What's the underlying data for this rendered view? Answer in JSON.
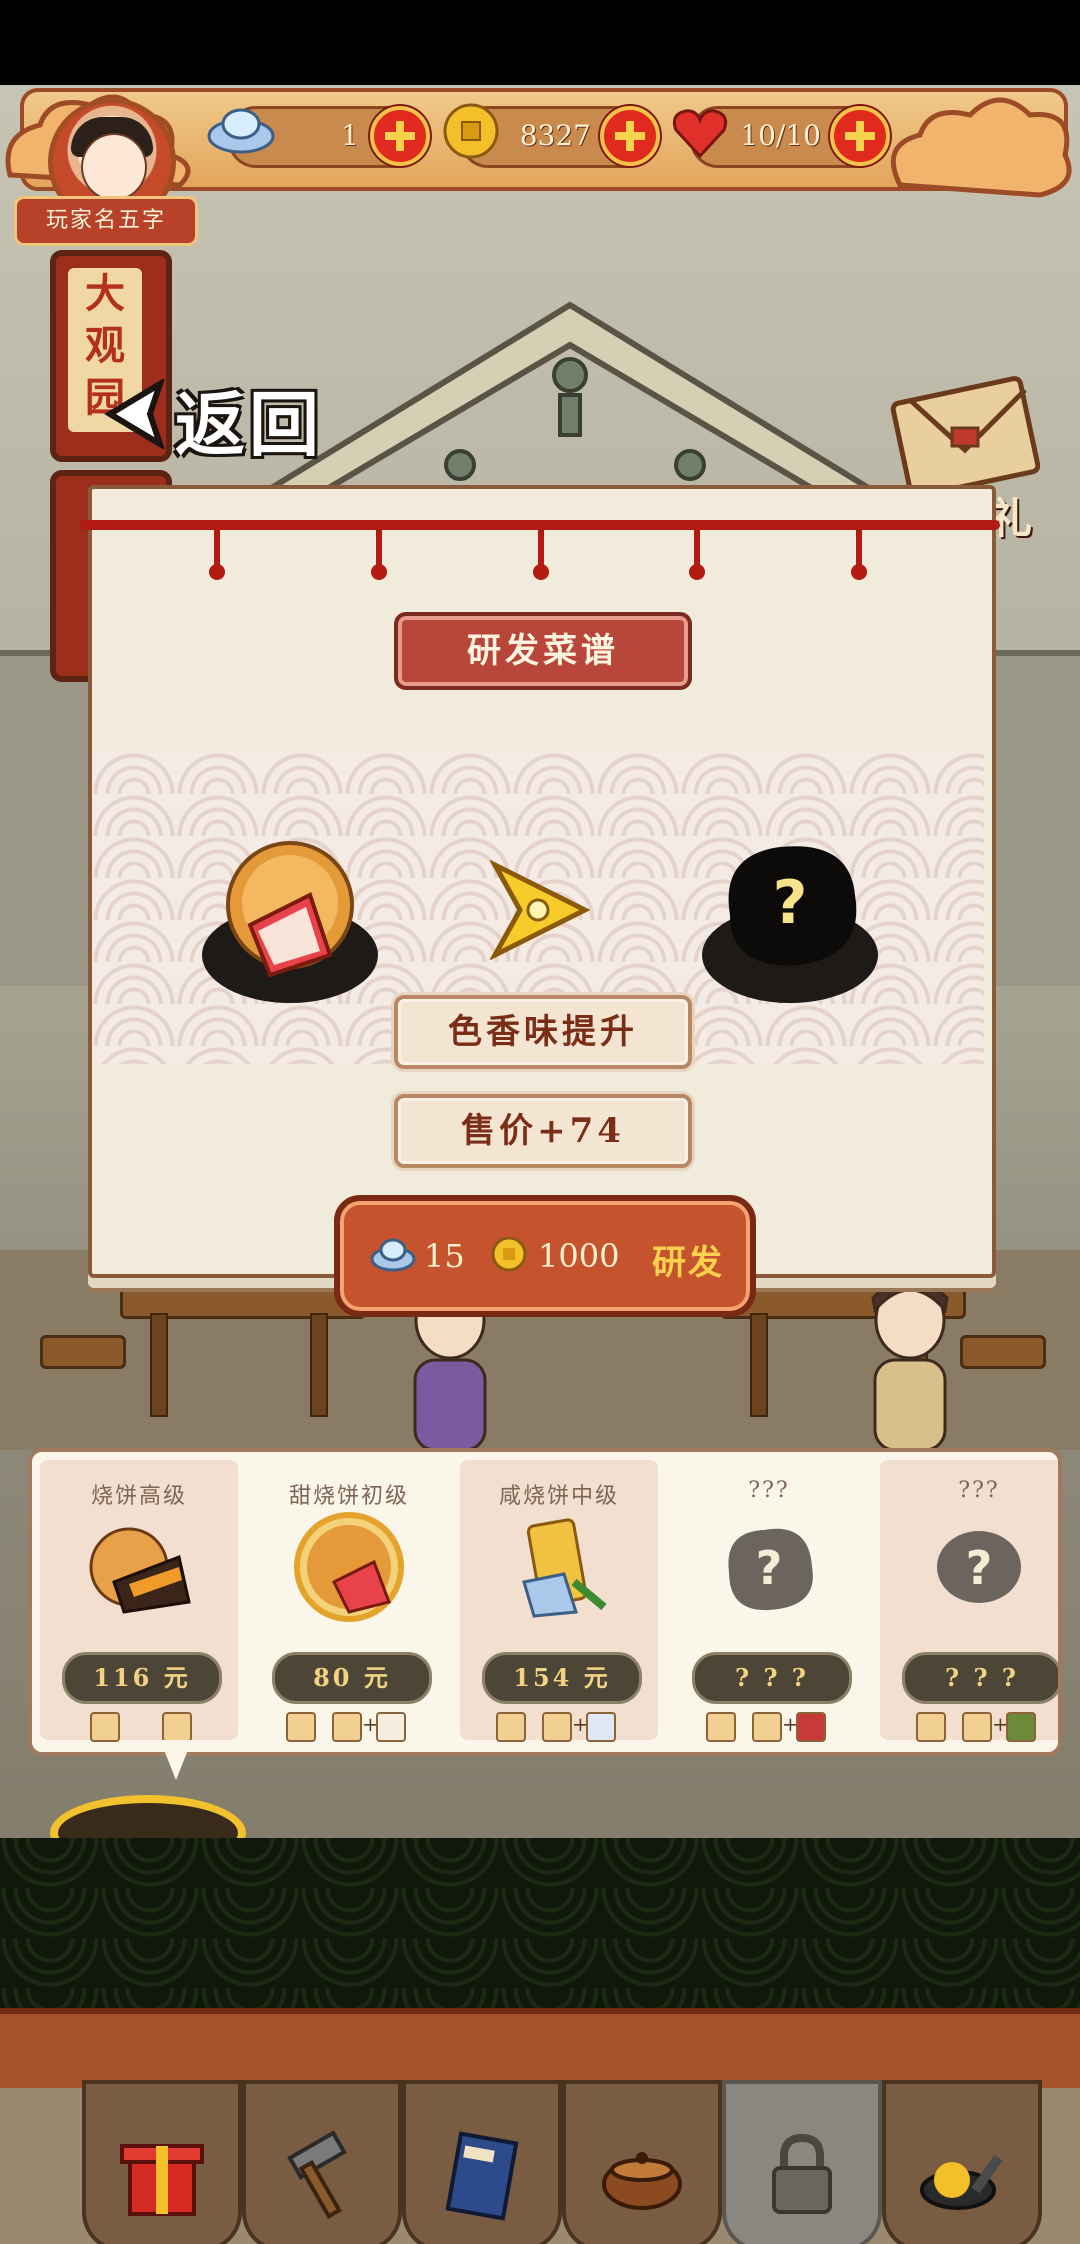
{
  "hud": {
    "silver": "1",
    "gold": "8327",
    "hearts": "10/10",
    "player_name": "玩家名五字"
  },
  "location_sign": "大观园",
  "back_label": "返回",
  "gift_label": "礼",
  "panel": {
    "title": "研发菜谱",
    "effect": "色香味提升",
    "price_bonus": "售价+74",
    "cost_silver": "15",
    "cost_gold": "1000",
    "develop_label": "研发"
  },
  "recipes": [
    {
      "name": "烧饼高级",
      "price": "116 元",
      "state": "unlocked"
    },
    {
      "name": "甜烧饼初级",
      "price": "80 元",
      "state": "selected"
    },
    {
      "name": "咸烧饼中级",
      "price": "154 元",
      "state": "unlocked"
    },
    {
      "name": "???",
      "price": "? ? ?",
      "state": "unknown"
    },
    {
      "name": "???",
      "price": "? ? ?",
      "state": "unknown"
    }
  ],
  "colors": {
    "accent_red": "#b9463a",
    "gold": "#f2c12e",
    "panel_bg": "#f1ebdc"
  }
}
